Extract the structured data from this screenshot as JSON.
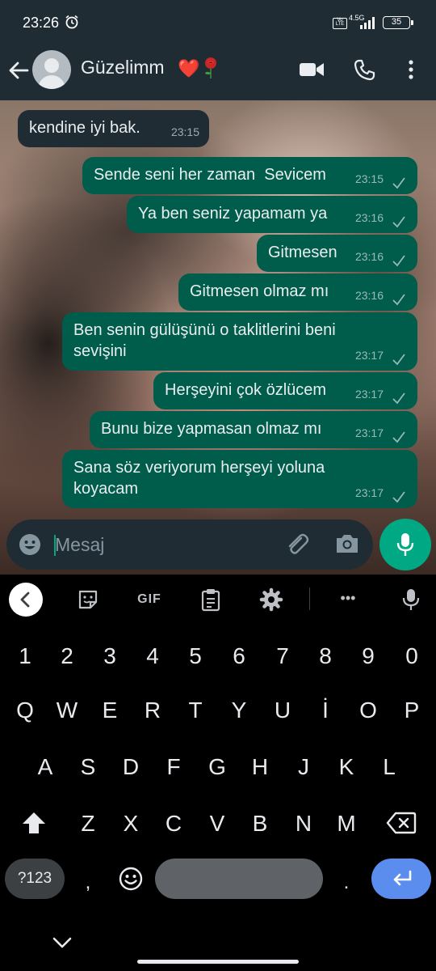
{
  "status_bar": {
    "time": "23:26",
    "network": "4.5G",
    "volte": "Vo LTE",
    "battery": "35"
  },
  "header": {
    "contact_name": "Güzelimm",
    "heart": "❤️",
    "icons": [
      "back-arrow-icon",
      "avatar",
      "rose-icon",
      "video-call-icon",
      "phone-icon",
      "more-menu-icon"
    ]
  },
  "messages": [
    {
      "direction": "in",
      "text": "kendine iyi bak.",
      "time": "23:15"
    },
    {
      "direction": "out",
      "text": "Sende seni her zaman  Sevicem",
      "time": "23:15",
      "status": "sent"
    },
    {
      "direction": "out",
      "text": "Ya ben seniz yapamam ya",
      "time": "23:16",
      "status": "sent"
    },
    {
      "direction": "out",
      "text": "Gitmesen",
      "time": "23:16",
      "status": "sent"
    },
    {
      "direction": "out",
      "text": "Gitmesen olmaz mı",
      "time": "23:16",
      "status": "sent"
    },
    {
      "direction": "out",
      "text": "Ben senin gülüşünü o taklitlerini beni\nsevişini",
      "time": "23:17",
      "status": "sent"
    },
    {
      "direction": "out",
      "text": "Herşeyini çok özlücem",
      "time": "23:17",
      "status": "sent"
    },
    {
      "direction": "out",
      "text": "Bunu bize yapmasan olmaz mı",
      "time": "23:17",
      "status": "sent"
    },
    {
      "direction": "out",
      "text": "Sana söz veriyorum herşeyi yoluna\nkoyacam",
      "time": "23:17",
      "status": "sent"
    }
  ],
  "composer": {
    "placeholder": "Mesaj",
    "value": ""
  },
  "keyboard": {
    "toolbar": [
      "collapse-icon",
      "sticker-icon",
      "GIF",
      "clipboard-icon",
      "settings-icon",
      "more-icon",
      "voice-icon"
    ],
    "gif_label": "GIF",
    "more_label": "•••",
    "rows": {
      "numbers": [
        "1",
        "2",
        "3",
        "4",
        "5",
        "6",
        "7",
        "8",
        "9",
        "0"
      ],
      "row1": [
        "Q",
        "W",
        "E",
        "R",
        "T",
        "Y",
        "U",
        "İ",
        "O",
        "P"
      ],
      "row2": [
        "A",
        "S",
        "D",
        "F",
        "G",
        "H",
        "J",
        "K",
        "L"
      ],
      "row3": [
        "Z",
        "X",
        "C",
        "V",
        "B",
        "N",
        "M"
      ]
    },
    "symbols_label": "?123",
    "comma": ",",
    "period": "."
  },
  "colors": {
    "header": "#1f2c34",
    "outgoing_bubble": "#005c4b",
    "incoming_bubble": "#1f2c34",
    "accent": "#00a884",
    "enter_key": "#5b8def"
  }
}
